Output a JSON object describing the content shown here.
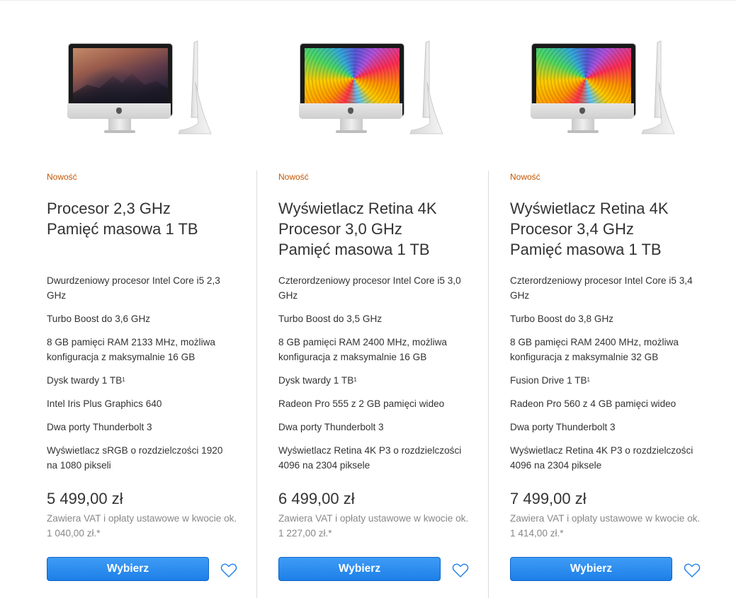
{
  "products": [
    {
      "image": "imac-sierra-wallpaper",
      "badge": "Nowość",
      "title_lines": [
        "Procesor 2,3 GHz",
        "Pamięć masowa 1 TB"
      ],
      "specs": [
        {
          "text": "Dwurdzeniowy procesor Intel Core i5 2,3 GHz"
        },
        {
          "text": "Turbo Boost do 3,6 GHz"
        },
        {
          "text": "8 GB pamięci RAM 2133 MHz, możliwa konfiguracja z maksymalnie 16 GB"
        },
        {
          "text": "Dysk twardy 1 TB",
          "sup": "1"
        },
        {
          "text": "Intel Iris Plus Graphics 640"
        },
        {
          "text": "Dwa porty Thunderbolt 3"
        },
        {
          "text": "Wyświetlacz sRGB o rozdzielczości 1920 na 1080 pikseli"
        }
      ],
      "price": "5 499,00 zł",
      "vat": "Zawiera VAT i opłaty ustawowe w kwocie ok. 1 040,00 zł.*",
      "button_label": "Wybierz",
      "heart_icon": "heart-outline-icon"
    },
    {
      "image": "imac-retina-swirl-wallpaper",
      "badge": "Nowość",
      "title_lines": [
        "Wyświetlacz Retina 4K",
        "Procesor 3,0 GHz",
        "Pamięć masowa 1 TB"
      ],
      "specs": [
        {
          "text": "Czterordzeniowy procesor Intel Core i5 3,0 GHz"
        },
        {
          "text": "Turbo Boost do 3,5 GHz"
        },
        {
          "text": "8 GB pamięci RAM 2400 MHz, możliwa konfiguracja z maksymalnie 16 GB"
        },
        {
          "text": "Dysk twardy 1 TB",
          "sup": "1"
        },
        {
          "text": "Radeon Pro 555 z 2 GB pamięci wideo"
        },
        {
          "text": "Dwa porty Thunderbolt 3"
        },
        {
          "text": "Wyświetlacz Retina 4K P3 o rozdzielczości 4096 na 2304 piksele"
        }
      ],
      "price": "6 499,00 zł",
      "vat": "Zawiera VAT i opłaty ustawowe w kwocie ok. 1 227,00 zł.*",
      "button_label": "Wybierz",
      "heart_icon": "heart-outline-icon"
    },
    {
      "image": "imac-retina-swirl-wallpaper",
      "badge": "Nowość",
      "title_lines": [
        "Wyświetlacz Retina 4K",
        "Procesor 3,4 GHz",
        "Pamięć masowa 1 TB"
      ],
      "specs": [
        {
          "text": "Czterordzeniowy procesor Intel Core i5 3,4 GHz"
        },
        {
          "text": "Turbo Boost do 3,8 GHz"
        },
        {
          "text": "8 GB pamięci RAM 2400 MHz, możliwa konfiguracja z maksymalnie 32 GB"
        },
        {
          "text": "Fusion Drive 1 TB",
          "sup": "1"
        },
        {
          "text": "Radeon Pro 560 z 4 GB pamięci wideo"
        },
        {
          "text": "Dwa porty Thunderbolt 3"
        },
        {
          "text": "Wyświetlacz Retina 4K P3 o rozdzielczości 4096 na 2304 piksele"
        }
      ],
      "price": "7 499,00 zł",
      "vat": "Zawiera VAT i opłaty ustawowe w kwocie ok. 1 414,00 zł.*",
      "button_label": "Wybierz",
      "heart_icon": "heart-outline-icon"
    }
  ],
  "colors": {
    "badge": "#c45500",
    "button": "#1d7fe8",
    "heart": "#1d7fe8",
    "muted_text": "#888888"
  }
}
